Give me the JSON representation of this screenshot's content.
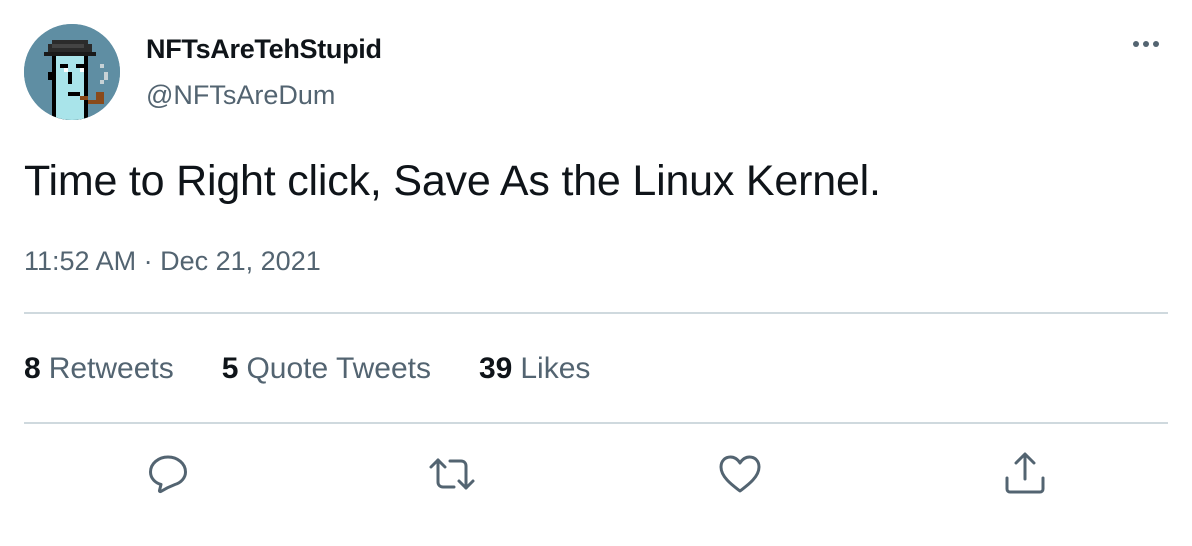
{
  "author": {
    "display_name": "NFTsAreTehStupid",
    "handle": "@NFTsAreDum"
  },
  "tweet": {
    "text": "Time to Right click, Save As the Linux Kernel.",
    "time": "11:52 AM",
    "separator": "·",
    "date": "Dec 21, 2021"
  },
  "stats": {
    "retweets": {
      "count": "8",
      "label": "Retweets"
    },
    "quote_tweets": {
      "count": "5",
      "label": "Quote Tweets"
    },
    "likes": {
      "count": "39",
      "label": "Likes"
    }
  },
  "icons": {
    "more": "more-horizontal-icon",
    "reply": "reply-icon",
    "retweet": "retweet-icon",
    "like": "heart-icon",
    "share": "share-icon"
  },
  "colors": {
    "text_primary": "#0f1419",
    "text_secondary": "#536471",
    "divider": "#cfd9de",
    "avatar_bg": "#5f8ea3"
  }
}
